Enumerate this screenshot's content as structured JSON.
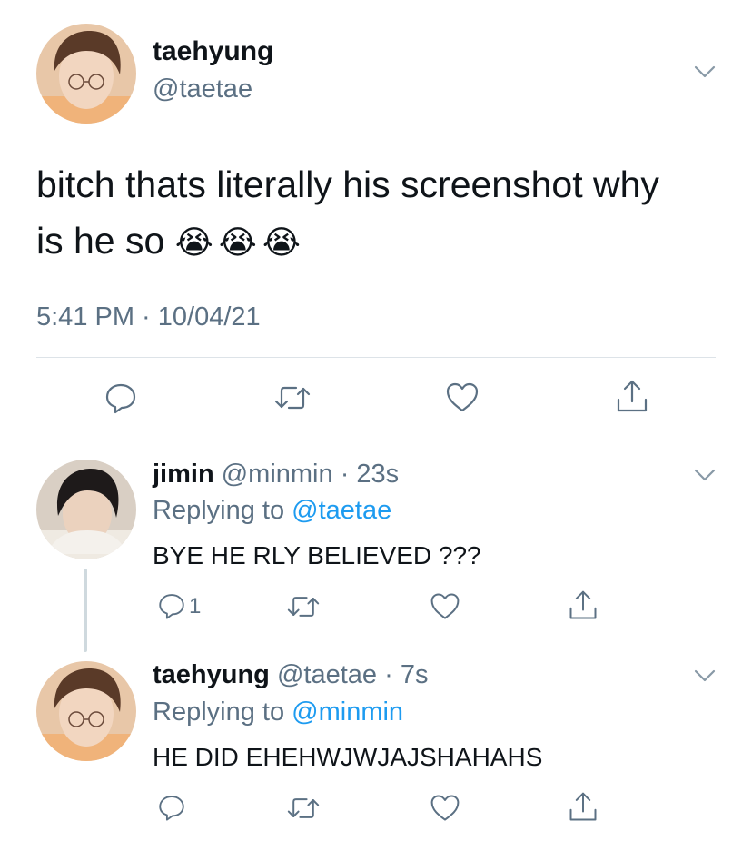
{
  "main_tweet": {
    "display_name": "taehyung",
    "handle": "@taetae",
    "text_line1": "bitch thats literally his screenshot why",
    "text_line2": "is he so",
    "emojis": "😭😭😭",
    "timestamp": "5:41 PM · 10/04/21"
  },
  "replies": [
    {
      "display_name": "jimin",
      "handle": "@minmin",
      "time": "· 23s",
      "replying_prefix": "Replying to",
      "replying_to": "@taetae",
      "text": "BYE HE RLY BELIEVED ???",
      "reply_count": "1"
    },
    {
      "display_name": "taehyung",
      "handle": "@taetae",
      "time": "· 7s",
      "replying_prefix": "Replying to",
      "replying_to": "@minmin",
      "text": "HE DID EHEHWJWJAJSHAHAHS",
      "reply_count": ""
    }
  ],
  "icons": {
    "reply": "reply-icon",
    "retweet": "retweet-icon",
    "like": "heart-icon",
    "share": "share-icon",
    "more": "chevron-down-icon"
  },
  "colors": {
    "text": "#0f1419",
    "muted": "#5b7083",
    "link": "#1d9bf0",
    "divider": "#dde3e8"
  }
}
